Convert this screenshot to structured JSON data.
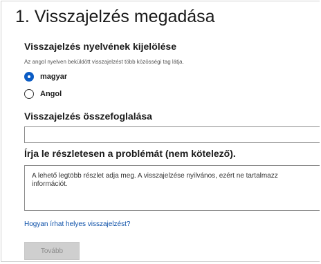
{
  "page": {
    "title": "1. Visszajelzés megadása"
  },
  "language_section": {
    "heading": "Visszajelzés nyelvének kijelölése",
    "hint": "Az angol nyelven beküldött visszajelzést több közösségi tag látja.",
    "options": [
      {
        "label": "magyar",
        "checked": true
      },
      {
        "label": "Angol",
        "checked": false
      }
    ]
  },
  "summary_section": {
    "heading": "Visszajelzés összefoglalása",
    "value": ""
  },
  "details_section": {
    "heading": "Írja le részletesen a problémát (nem kötelező).",
    "placeholder_line1": "A lehető legtöbb részlet adja meg. A visszajelzése nyilvános, ezért ne tartalmazz",
    "placeholder_line2": "információt."
  },
  "help_link": "Hogyan írhat helyes visszajelzést?",
  "next_button": {
    "label": "Tovább",
    "enabled": false
  },
  "colors": {
    "accent": "#0b5cc5",
    "link": "#0b4fa8",
    "disabled_button_bg": "#cfcfcf"
  }
}
